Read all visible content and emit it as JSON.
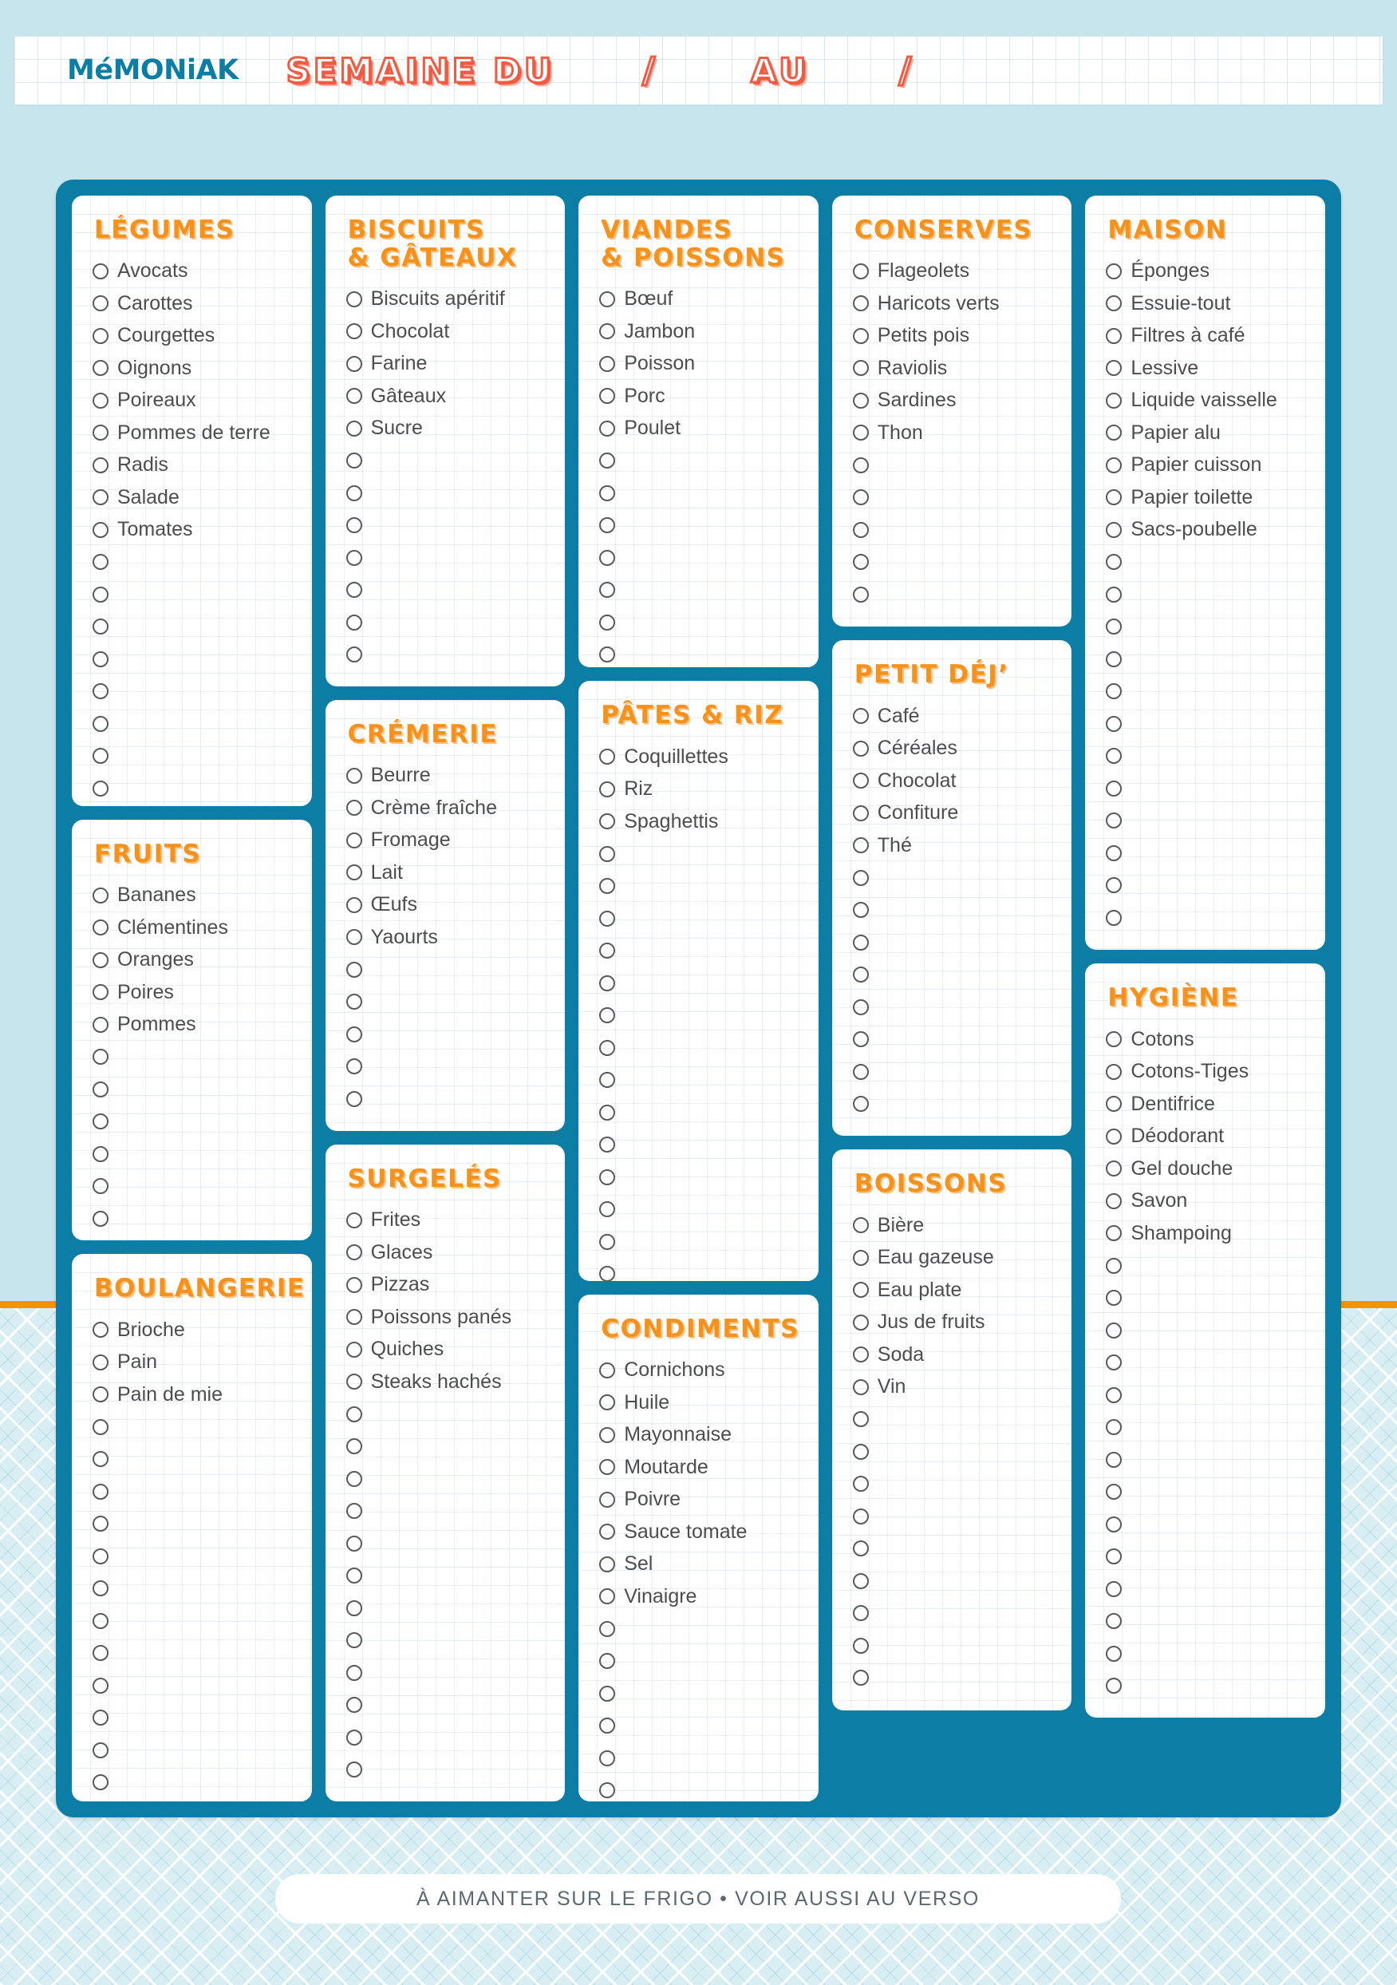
{
  "brand": {
    "name": "MéMONiAK"
  },
  "header": {
    "title": "SEMAINE DU",
    "slash_1": "/",
    "connector": "AU",
    "slash_2": "/"
  },
  "footer": {
    "text": "À AIMANTER SUR LE FRIGO • VOIR AUSSI AU VERSO"
  },
  "colors": {
    "board_blue": "#0c7ea6",
    "title_orange": "#f5921e",
    "header_red": "#ef5b43",
    "page_blue": "#c7e5ec",
    "accent_orange_bar": "#f29400",
    "bullet_gray": "#5a5a5a",
    "item_text": "#4d4d4d"
  },
  "columns": [
    {
      "cards": [
        {
          "title": "LÉGUMES",
          "items": [
            "Avocats",
            "Carottes",
            "Courgettes",
            "Oignons",
            "Poireaux",
            "Pommes de terre",
            "Radis",
            "Salade",
            "Tomates"
          ],
          "blank_count": 8
        },
        {
          "title": "FRUITS",
          "items": [
            "Bananes",
            "Clémentines",
            "Oranges",
            "Poires",
            "Pommes"
          ],
          "blank_count": 6
        },
        {
          "title": "BOULANGERIE",
          "items": [
            "Brioche",
            "Pain",
            "Pain de mie"
          ],
          "blank_count": 12
        }
      ]
    },
    {
      "cards": [
        {
          "title": "BISCUITS\n& GÂTEAUX",
          "items": [
            "Biscuits apéritif",
            "Chocolat",
            "Farine",
            "Gâteaux",
            "Sucre"
          ],
          "blank_count": 7
        },
        {
          "title": "CRÉMERIE",
          "items": [
            "Beurre",
            "Crème fraîche",
            "Fromage",
            "Lait",
            "Œufs",
            "Yaourts"
          ],
          "blank_count": 5
        },
        {
          "title": "SURGELÉS",
          "items": [
            "Frites",
            "Glaces",
            "Pizzas",
            "Poissons panés",
            "Quiches",
            "Steaks hachés"
          ],
          "blank_count": 12
        }
      ]
    },
    {
      "cards": [
        {
          "title": "VIANDES\n& POISSONS",
          "items": [
            "Bœuf",
            "Jambon",
            "Poisson",
            "Porc",
            "Poulet"
          ],
          "blank_count": 7
        },
        {
          "title": "PÂTES & RIZ",
          "items": [
            "Coquillettes",
            "Riz",
            "Spaghettis"
          ],
          "blank_count": 14
        },
        {
          "title": "CONDIMENTS",
          "items": [
            "Cornichons",
            "Huile",
            "Mayonnaise",
            "Moutarde",
            "Poivre",
            "Sauce tomate",
            "Sel",
            "Vinaigre"
          ],
          "blank_count": 6
        }
      ]
    },
    {
      "cards": [
        {
          "title": "CONSERVES",
          "items": [
            "Flageolets",
            "Haricots verts",
            "Petits pois",
            "Raviolis",
            "Sardines",
            "Thon"
          ],
          "blank_count": 5
        },
        {
          "title": "PETIT DÉJ’",
          "items": [
            "Café",
            "Céréales",
            "Chocolat",
            "Confiture",
            "Thé"
          ],
          "blank_count": 8
        },
        {
          "title": "BOISSONS",
          "items": [
            "Bière",
            "Eau gazeuse",
            "Eau plate",
            "Jus de fruits",
            "Soda",
            "Vin"
          ],
          "blank_count": 9
        }
      ]
    },
    {
      "cards": [
        {
          "title": "MAISON",
          "items": [
            "Éponges",
            "Essuie-tout",
            "Filtres à café",
            "Lessive",
            "Liquide vaisselle",
            "Papier alu",
            "Papier cuisson",
            "Papier toilette",
            "Sacs-poubelle"
          ],
          "blank_count": 12
        },
        {
          "title": "HYGIÈNE",
          "items": [
            "Cotons",
            "Cotons-Tiges",
            "Dentifrice",
            "Déodorant",
            "Gel douche",
            "Savon",
            "Shampoing"
          ],
          "blank_count": 14
        }
      ]
    }
  ]
}
